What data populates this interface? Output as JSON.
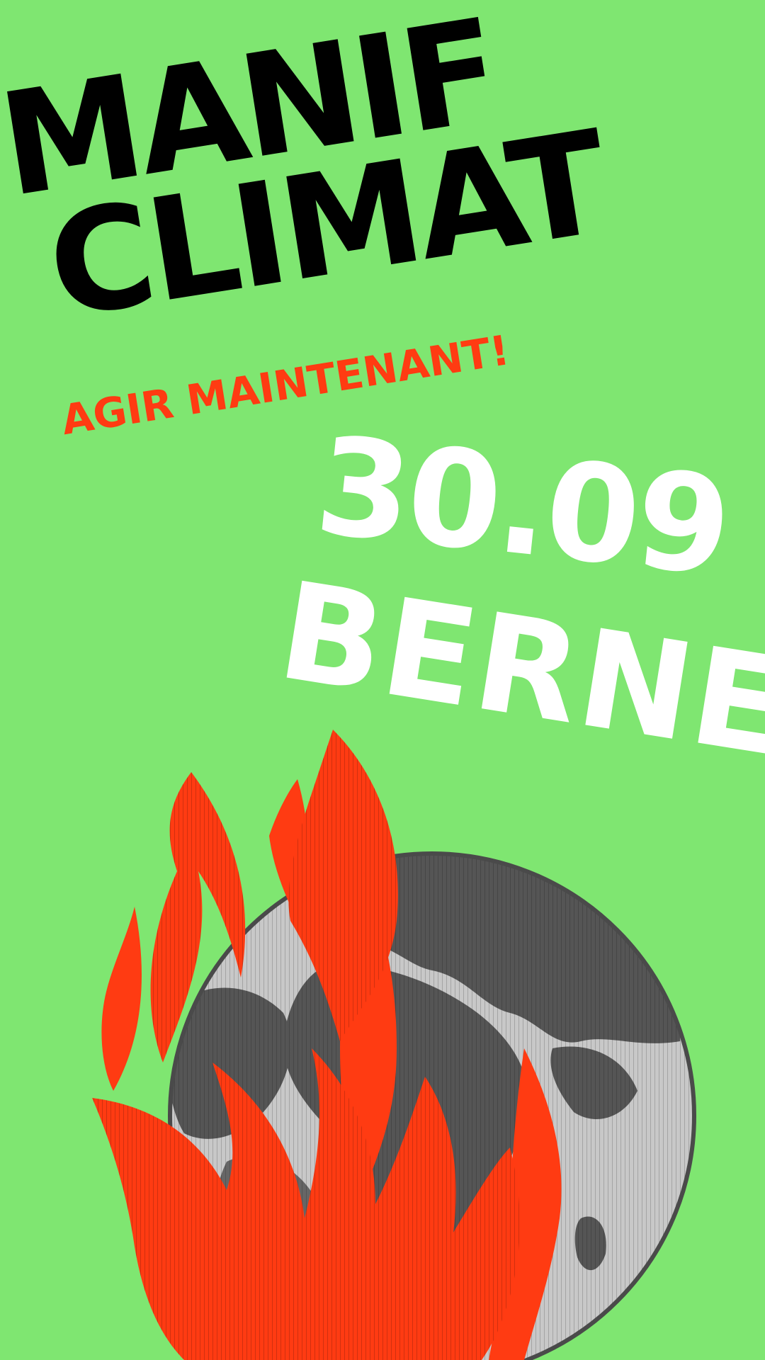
{
  "poster": {
    "headline_line1": "MANIF",
    "headline_line2": "CLIMAT",
    "subtitle": "AGIR MAINTENANT!",
    "date": "30.09",
    "city": "BERNE"
  },
  "illustration": {
    "icon": "burning-earth-icon"
  },
  "colors": {
    "background": "#7fe671",
    "headline": "#000000",
    "accent": "#ff3b12",
    "event_text": "#ffffff",
    "globe_light": "#c8c8c8",
    "globe_dark": "#555555"
  }
}
